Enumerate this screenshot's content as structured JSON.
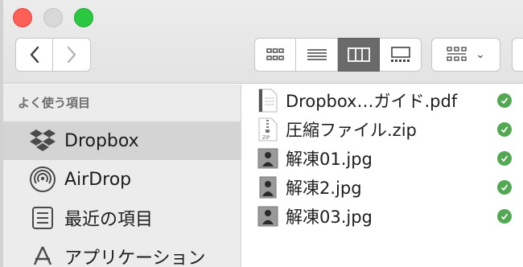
{
  "toolbar": {
    "back_icon": "chevron-left-icon",
    "forward_icon": "chevron-right-icon",
    "view_modes": [
      "icon-view",
      "list-view",
      "column-view",
      "gallery-view"
    ],
    "active_view": "column-view",
    "arrange_icon": "group-by-icon",
    "arrange_chevron": "⌄"
  },
  "sidebar": {
    "heading": "よく使う項目",
    "items": [
      {
        "label": "Dropbox",
        "icon": "dropbox-icon",
        "selected": true
      },
      {
        "label": "AirDrop",
        "icon": "airdrop-icon",
        "selected": false
      },
      {
        "label": "最近の項目",
        "icon": "recents-icon",
        "selected": false
      },
      {
        "label": "アプリケーション",
        "icon": "applications-icon",
        "selected": false
      }
    ]
  },
  "files": [
    {
      "name": "Dropbox…ガイド.pdf",
      "icon": "pdf-file-icon",
      "status": "synced"
    },
    {
      "name": "圧縮ファイル.zip",
      "icon": "zip-file-icon",
      "status": "synced"
    },
    {
      "name": "解凍01.jpg",
      "icon": "image-file-icon",
      "status": "synced"
    },
    {
      "name": "解凍2.jpg",
      "icon": "image-file-icon",
      "status": "synced"
    },
    {
      "name": "解凍03.jpg",
      "icon": "image-file-icon",
      "status": "synced"
    }
  ],
  "colors": {
    "close": "#fe5f57",
    "zoom": "#2ac840",
    "sync_ok": "#54a854",
    "dropbox_blue": "#2f6fd6"
  }
}
